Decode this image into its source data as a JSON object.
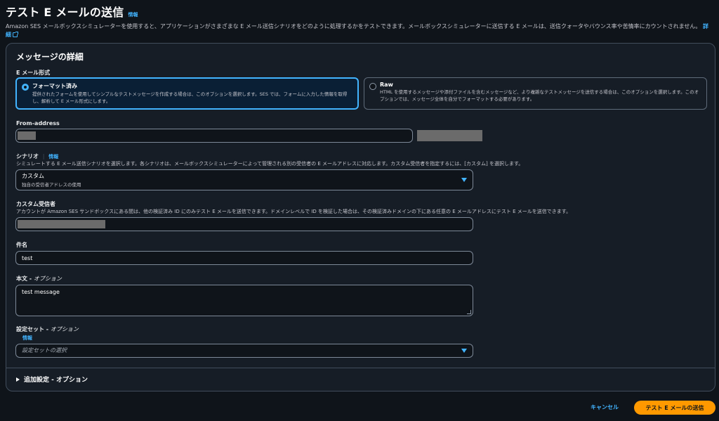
{
  "header": {
    "title": "テスト E メールの送信",
    "info": "情報",
    "description": "Amazon SES メールボックスシミュレーターを使用すると、アプリケーションがさまざまな E メール送信シナリオをどのように処理するかをテストできます。メールボックスシミュレーターに送信する E メールは、送信クォータやバウンス率や苦情率にカウントされません。",
    "details_link": "詳細"
  },
  "message": {
    "section_title": "メッセージの詳細",
    "format_label": "E メール形式",
    "formats": [
      {
        "title": "フォーマット済み",
        "description": "提供されたフォームを使用してシンプルなテストメッセージを作成する場合は、このオプションを選択します。SES では、フォームに入力した情報を取得し、解析して E メール形式にします。",
        "selected": true
      },
      {
        "title": "Raw",
        "description": "HTML を使用するメッセージや添付ファイルを含むメッセージなど、より複雑なテストメッセージを送信する場合は、このオプションを選択します。このオプションでは、メッセージ全体を自分でフォーマットする必要があります。",
        "selected": false
      }
    ],
    "from_label": "From-address",
    "scenario_label": "シナリオ",
    "scenario_info": "情報",
    "scenario_desc": "シミュレートする E メール送信シナリオを選択します。各シナリオは、メールボックスシミュレーターによって管理される別の受信者の E メールアドレスに対応します。カスタム受信者を指定するには、[カスタム] を選択します。",
    "scenario_value": "カスタム",
    "scenario_secondary": "独自の受信者アドレスの使用",
    "custom_label": "カスタム受信者",
    "custom_desc": "アカウントが Amazon SES サンドボックスにある間は、他の検証済み ID にのみテスト E メールを送信できます。ドメインレベルで ID を検証した場合は、その検証済みドメインの下にある任意の E メールアドレスにテスト E メールを送信できます。",
    "subject_label": "件名",
    "subject_value": "test",
    "body_label": "本文 - ",
    "body_optional": "オプション",
    "body_value": "test message",
    "config_label": "設定セット - ",
    "config_optional": "オプション",
    "config_info": "情報",
    "config_placeholder": "設定セットの選択",
    "additional_label": "追加設定 - オプション"
  },
  "footer": {
    "cancel": "キャンセル",
    "send": "テスト E メールの送信"
  }
}
